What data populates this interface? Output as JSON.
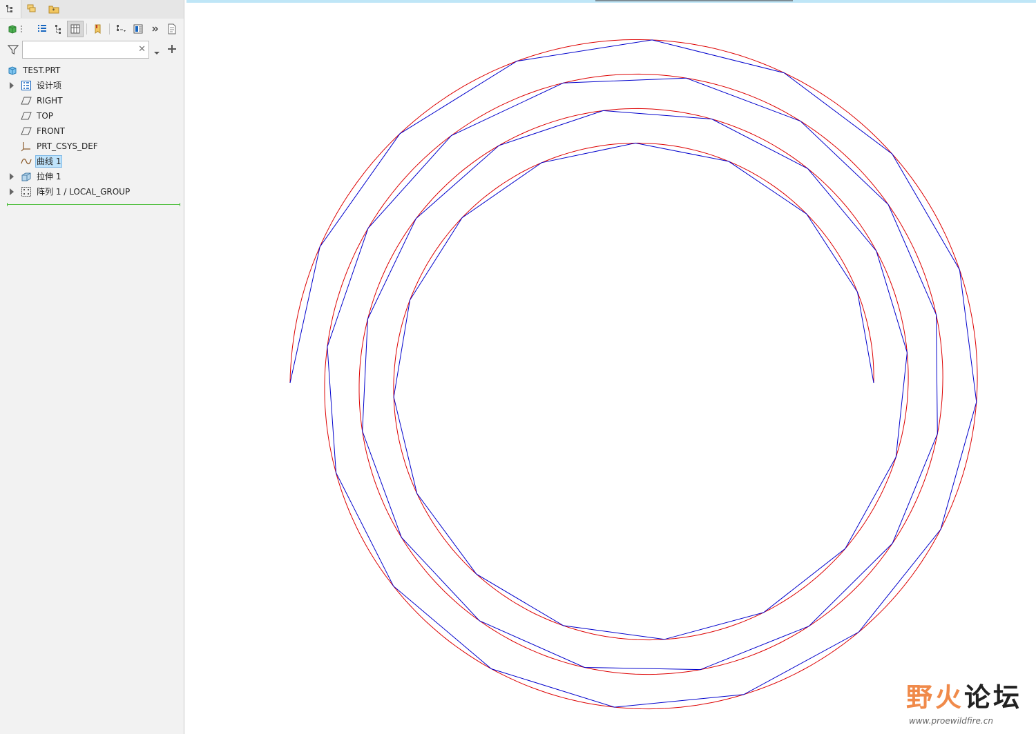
{
  "panel": {
    "search": {
      "value": "",
      "placeholder": ""
    }
  },
  "tree": {
    "root": "TEST.PRT",
    "items": [
      {
        "label": "设计项",
        "icon": "design-items-icon",
        "expandable": true
      },
      {
        "label": "RIGHT",
        "icon": "datum-plane-icon",
        "expandable": false
      },
      {
        "label": "TOP",
        "icon": "datum-plane-icon",
        "expandable": false
      },
      {
        "label": "FRONT",
        "icon": "datum-plane-icon",
        "expandable": false
      },
      {
        "label": "PRT_CSYS_DEF",
        "icon": "csys-icon",
        "expandable": false
      },
      {
        "label": "曲线 1",
        "icon": "curve-icon",
        "expandable": false,
        "selected": true
      },
      {
        "label": "拉伸 1",
        "icon": "extrude-icon",
        "expandable": true
      },
      {
        "label": "阵列 1 / LOCAL_GROUP",
        "icon": "pattern-icon",
        "expandable": true
      }
    ]
  },
  "colors": {
    "smooth_curve": "#dd0000",
    "polyline": "#0000cc",
    "selection": "#bfe3fb",
    "insert_line": "#4fbf3f",
    "accent_top": "#bfe6f7"
  },
  "watermark": {
    "title_light": "野火",
    "title_dark": "论坛",
    "url": "www.proewildfire.cn"
  }
}
